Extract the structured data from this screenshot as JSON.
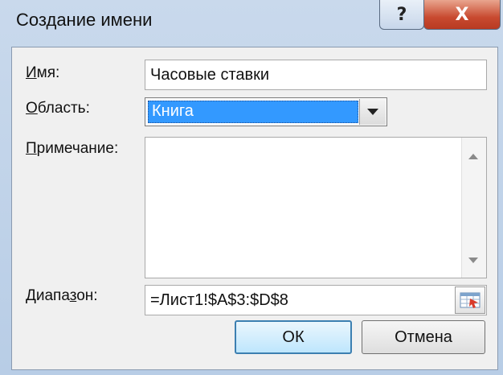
{
  "window": {
    "title": "Создание имени",
    "help_label": "?",
    "close_label": "X"
  },
  "form": {
    "name_label_u": "И",
    "name_label_rest": "мя:",
    "name_value": "Часовые ставки",
    "scope_label_u": "О",
    "scope_label_rest": "бласть:",
    "scope_value": "Книга",
    "comment_label_u": "П",
    "comment_label_rest": "римечание:",
    "comment_value": "",
    "range_label_pre": "Диапа",
    "range_label_u": "з",
    "range_label_post": "он:",
    "range_value": "=Лист1!$A$3:$D$8"
  },
  "buttons": {
    "ok": "ОК",
    "cancel": "Отмена"
  },
  "icons": {
    "scope_dropdown": "chevron-down-icon",
    "range_picker": "range-select-icon",
    "scroll_up": "scroll-up-icon",
    "scroll_down": "scroll-down-icon"
  }
}
